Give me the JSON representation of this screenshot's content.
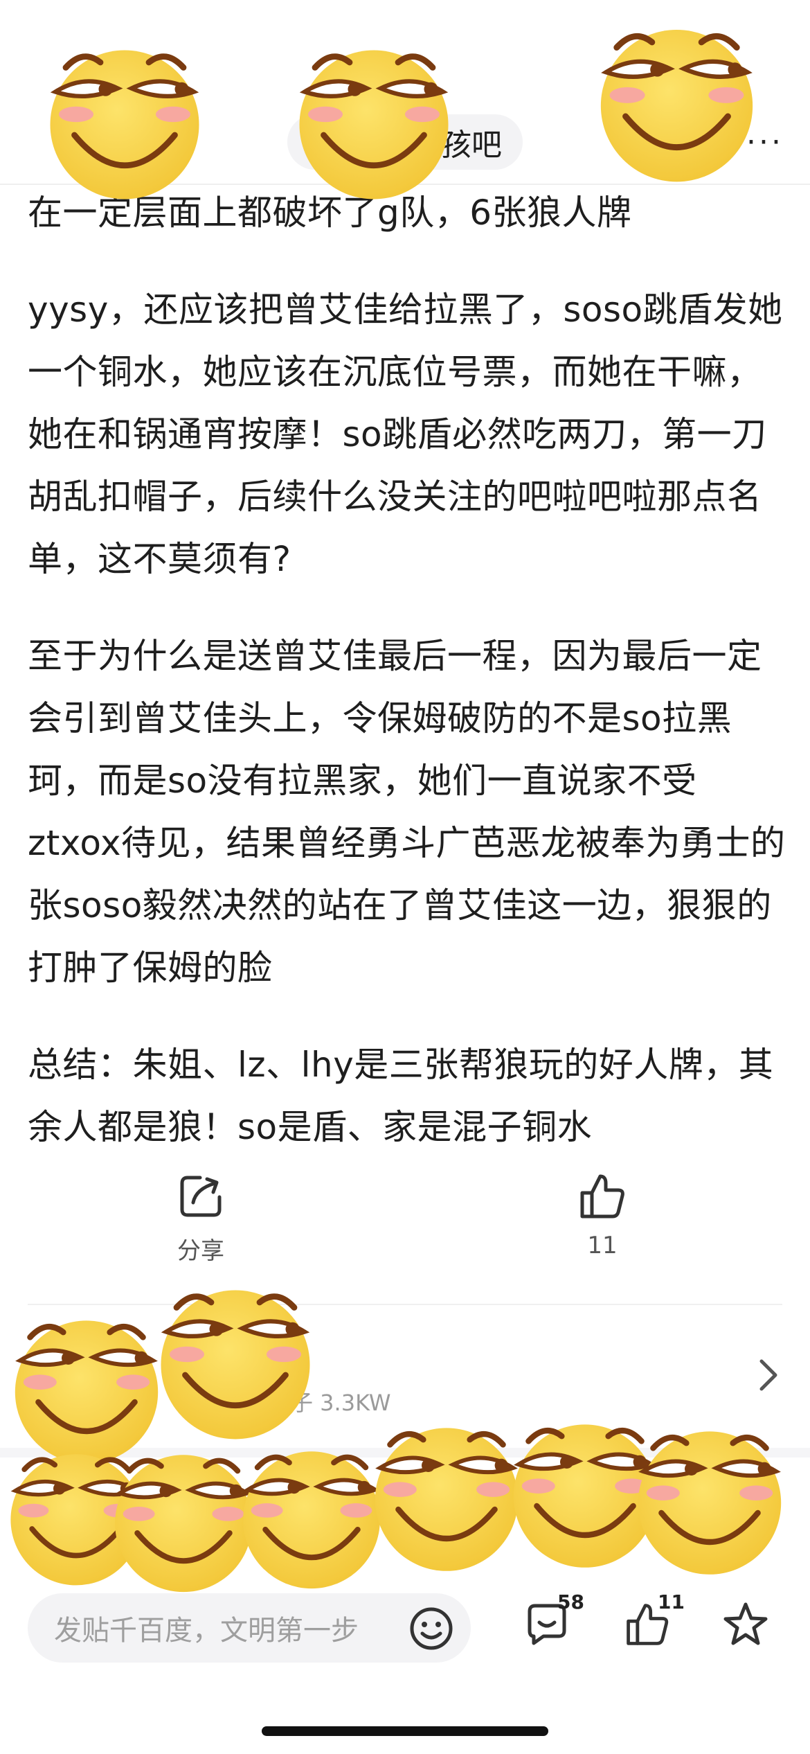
{
  "header": {
    "forum_name_partial": "孩吧",
    "more_label": "···"
  },
  "article": {
    "paragraphs": [
      "在一定层面上都破坏了g队，6张狼人牌",
      "yysy，还应该把曾艾佳给拉黑了，soso跳盾发她一个铜水，她应该在沉底位号票，而她在干嘛，她在和锅通宵按摩！so跳盾必然吃两刀，第一刀胡乱扣帽子，后续什么没关注的吧啦吧啦那点名单，这不莫须有?",
      "至于为什么是送曾艾佳最后一程，因为最后一定会引到曾艾佳头上，令保姆破防的不是so拉黑珂，而是so没有拉黑家，她们一直说家不受ztxox待见，结果曾经勇斗广芭恶龙被奉为勇士的张soso毅然决然的站在了曾艾佳这一边，狠狠的打肿了保姆的脸",
      "总结：朱姐、lz、lhy是三张帮狼玩的好人牌，其余人都是狼！so是盾、家是混子铜水"
    ]
  },
  "actions": {
    "share_label": "分享",
    "like_count": "11"
  },
  "forum_entry": {
    "stats_partial": "子 3.3KW"
  },
  "bottom_bar": {
    "input_placeholder": "发贴千百度，文明第一步",
    "comment_count": "58",
    "like_count": "11"
  },
  "icons": {
    "share": "share-icon",
    "like": "thumbs-up-icon",
    "emoji": "emoji-icon",
    "comment": "comment-icon",
    "star": "star-icon",
    "chevron": "chevron-right-icon",
    "sticker": "smirk-emoji-sticker"
  },
  "colors": {
    "sticker_face": "#f9d84a",
    "sticker_blush": "#f7a8a0",
    "sticker_outline": "#7a3b10"
  }
}
